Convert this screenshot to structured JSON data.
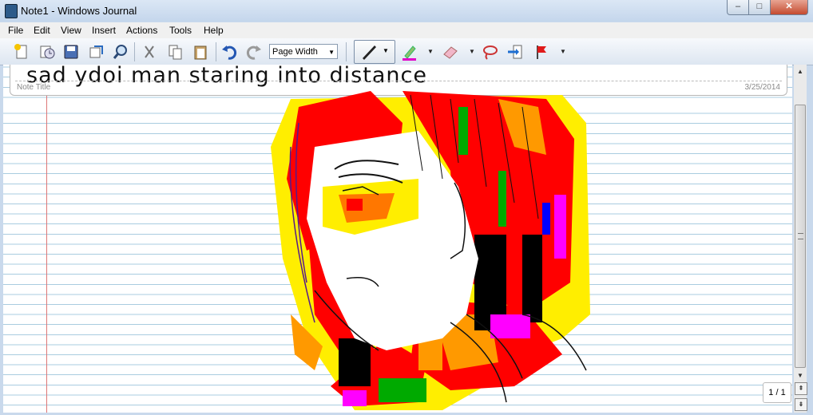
{
  "window": {
    "title": "Note1 - Windows Journal",
    "minimize": "–",
    "maximize": "□",
    "close": "✕"
  },
  "menu": [
    "File",
    "Edit",
    "View",
    "Insert",
    "Actions",
    "Tools",
    "Help"
  ],
  "toolbar": {
    "zoom_value": "Page Width",
    "icons": [
      "new-note-icon",
      "open-icon",
      "save-icon",
      "send-email-icon",
      "find-icon",
      "cut-icon",
      "copy-icon",
      "paste-icon",
      "undo-icon",
      "redo-icon",
      "pen-icon",
      "highlighter-icon",
      "eraser-icon",
      "lasso-select-icon",
      "insert-space-icon",
      "flag-icon"
    ],
    "pen_color": "#222222",
    "highlighter_color": "#e000c8"
  },
  "note": {
    "title_ink": "sad ydoi man staring into distance",
    "title_label": "Note Title",
    "date": "3/25/2014",
    "ink_colors": [
      "#ff0000",
      "#ffee00",
      "#ff9900",
      "#00aa00",
      "#0000ff",
      "#ff00ff",
      "#000000"
    ]
  },
  "status": {
    "page_counter": "1 / 1"
  }
}
